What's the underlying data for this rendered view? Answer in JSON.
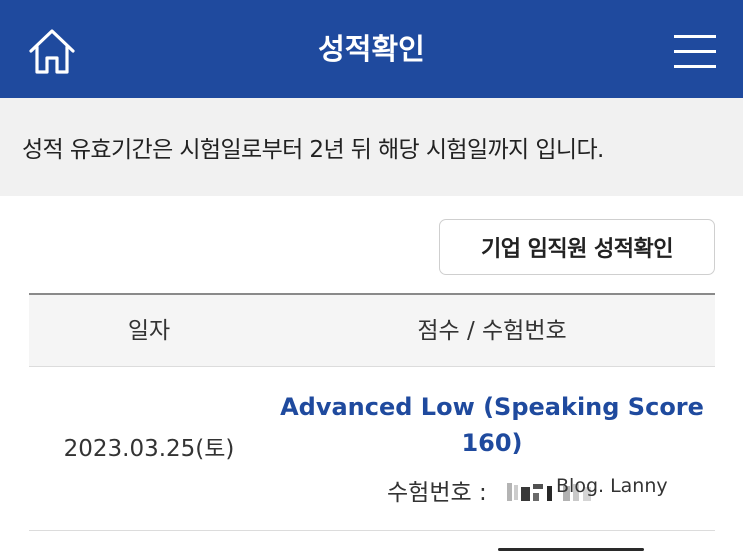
{
  "header": {
    "title": "성적확인",
    "home_icon": "home-icon",
    "menu_icon": "hamburger-menu-icon",
    "background": "#1f4a9e"
  },
  "notice": {
    "text": "성적 유효기간은 시험일로부터 2년 뒤 해당 시험일까지 입니다."
  },
  "corporate_button": {
    "label": "기업 임직원 성적확인"
  },
  "table": {
    "columns": [
      "일자",
      "점수 / 수험번호"
    ],
    "rows": [
      {
        "date": "2023.03.25(토)",
        "score_line1": "Advanced Low (Speaking Score",
        "score_line2": "160)",
        "exam_label": "수험번호 :",
        "watermark": "Blog. Lanny"
      }
    ]
  },
  "colors": {
    "accent": "#1f4a9e",
    "notice_bg": "#f1f1f1",
    "table_head_bg": "#f5f5f5"
  }
}
